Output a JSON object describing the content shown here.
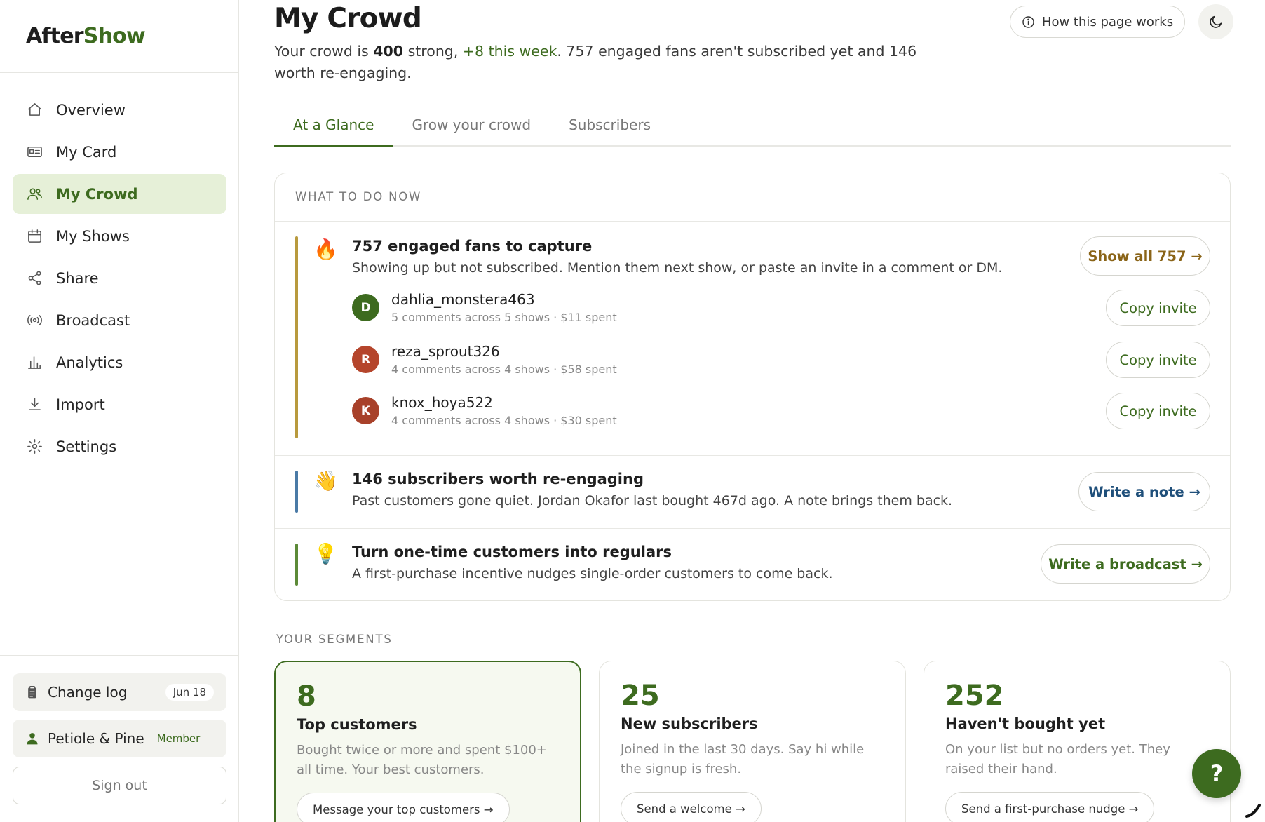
{
  "app": {
    "logo_after": "After",
    "logo_show": "Show"
  },
  "sidebar": {
    "items": [
      {
        "label": "Overview",
        "icon": "home-icon"
      },
      {
        "label": "My Card",
        "icon": "id-card-icon"
      },
      {
        "label": "My Crowd",
        "icon": "users-icon",
        "active": true
      },
      {
        "label": "My Shows",
        "icon": "calendar-icon"
      },
      {
        "label": "Share",
        "icon": "share-icon"
      },
      {
        "label": "Broadcast",
        "icon": "broadcast-icon"
      },
      {
        "label": "Analytics",
        "icon": "bar-chart-icon"
      },
      {
        "label": "Import",
        "icon": "download-icon"
      },
      {
        "label": "Settings",
        "icon": "gear-icon"
      }
    ],
    "changelog": {
      "label": "Change log",
      "date": "Jun 18"
    },
    "member": {
      "name": "Petiole & Pine",
      "badge": "Member"
    },
    "signout": "Sign out"
  },
  "header": {
    "title": "My Crowd",
    "how_button": "How this page works",
    "summary": {
      "prefix": "Your crowd is ",
      "count": "400",
      "mid": " strong, ",
      "growth": "+8 this week",
      "rest": ". 757 engaged fans aren't subscribed yet and 146 worth re-engaging."
    }
  },
  "tabs": [
    {
      "label": "At a Glance",
      "active": true
    },
    {
      "label": "Grow your crowd"
    },
    {
      "label": "Subscribers"
    }
  ],
  "todo": {
    "label": "WHAT TO DO NOW",
    "capture": {
      "emoji": "🔥",
      "title": "757 engaged fans to capture",
      "desc": "Showing up but not subscribed. Mention them next show, or paste an invite in a comment or DM.",
      "button": "Show all 757 →",
      "bar_color": "#b89a3e",
      "fans": [
        {
          "initial": "D",
          "name": "dahlia_monstera463",
          "meta": "5 comments across 5 shows · $11 spent",
          "color": "#3d6b1f",
          "action": "Copy invite"
        },
        {
          "initial": "R",
          "name": "reza_sprout326",
          "meta": "4 comments across 4 shows · $58 spent",
          "color": "#b5452c",
          "action": "Copy invite"
        },
        {
          "initial": "K",
          "name": "knox_hoya522",
          "meta": "4 comments across 4 shows · $30 spent",
          "color": "#a8412a",
          "action": "Copy invite"
        }
      ]
    },
    "reengage": {
      "emoji": "👋",
      "title": "146 subscribers worth re-engaging",
      "desc": "Past customers gone quiet. Jordan Okafor last bought 467d ago. A note brings them back.",
      "button": "Write a note →",
      "bar_color": "#4a7aa6"
    },
    "regulars": {
      "emoji": "💡",
      "title": "Turn one-time customers into regulars",
      "desc": "A first-purchase incentive nudges single-order customers to come back.",
      "button": "Write a broadcast →",
      "bar_color": "#5c8a38"
    }
  },
  "segments": {
    "label": "YOUR SEGMENTS",
    "cards": [
      {
        "num": "8",
        "title": "Top customers",
        "desc": "Bought twice or more and spent $100+ all time. Your best customers.",
        "button": "Message your top customers →"
      },
      {
        "num": "25",
        "title": "New subscribers",
        "desc": "Joined in the last 30 days. Say hi while the signup is fresh.",
        "button": "Send a welcome →"
      },
      {
        "num": "252",
        "title": "Haven't bought yet",
        "desc": "On your list but no orders yet. They raised their hand.",
        "button": "Send a first-purchase nudge →"
      }
    ]
  },
  "help": "?"
}
